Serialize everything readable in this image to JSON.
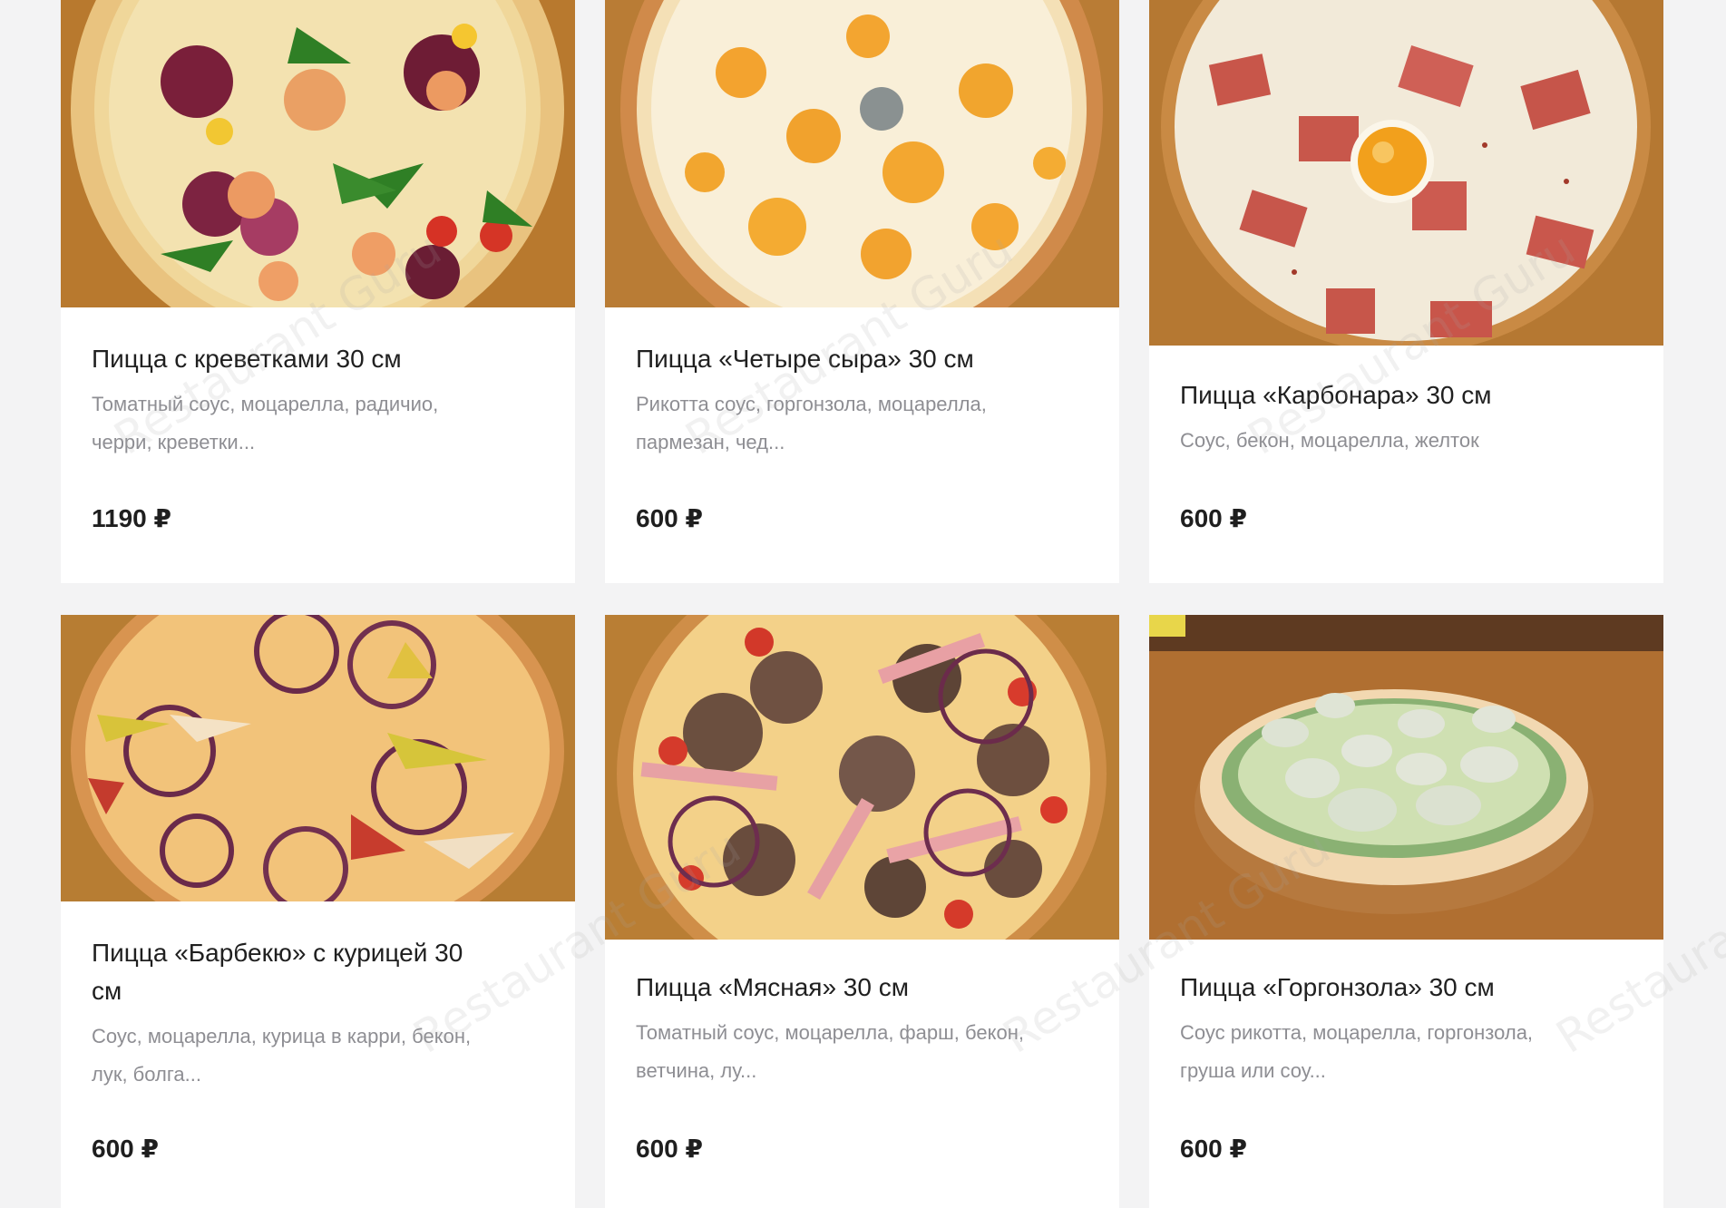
{
  "currency_note": "",
  "colors": {
    "background": "#f3f3f4",
    "card": "#ffffff",
    "title": "#202020",
    "description": "#8e8e93",
    "price": "#1f1f1f"
  },
  "products": [
    {
      "title": "Пицца с креветками 30 см",
      "description_line1": "Томатный соус, моцарелла, радичио,",
      "description_line2": "черри, креветки...",
      "price": "1190 ₽",
      "image_icon": "shrimp-pizza-photo"
    },
    {
      "title": "Пицца «Четыре сыра» 30 см",
      "description_line1": "Рикотта соус, горгонзола, моцарелла,",
      "description_line2": "пармезан, чед...",
      "price": "600 ₽",
      "image_icon": "four-cheese-pizza-photo"
    },
    {
      "title": "Пицца «Карбонара» 30 см",
      "description_line1": "Соус, бекон, моцарелла, желток",
      "description_line2": "",
      "price": "600 ₽",
      "image_icon": "carbonara-pizza-photo"
    },
    {
      "title_line1": "Пицца «Барбекю» с курицей 30",
      "title_line2": "см",
      "description_line1": "Соус, моцарелла, курица в карри, бекон,",
      "description_line2": "лук, болга...",
      "price": "600 ₽",
      "image_icon": "bbq-chicken-pizza-photo"
    },
    {
      "title": "Пицца «Мясная» 30 см",
      "description_line1": "Томатный соус, моцарелла, фарш, бекон,",
      "description_line2": "ветчина, лу...",
      "price": "600 ₽",
      "image_icon": "meat-pizza-photo"
    },
    {
      "title": "Пицца «Горгонзола» 30 см",
      "description_line1": "Соус рикотта, моцарелла, горгонзола,",
      "description_line2": "груша или соу...",
      "price": "600 ₽",
      "image_icon": "gorgonzola-pizza-photo"
    }
  ],
  "watermark": "Restaurant Guru"
}
